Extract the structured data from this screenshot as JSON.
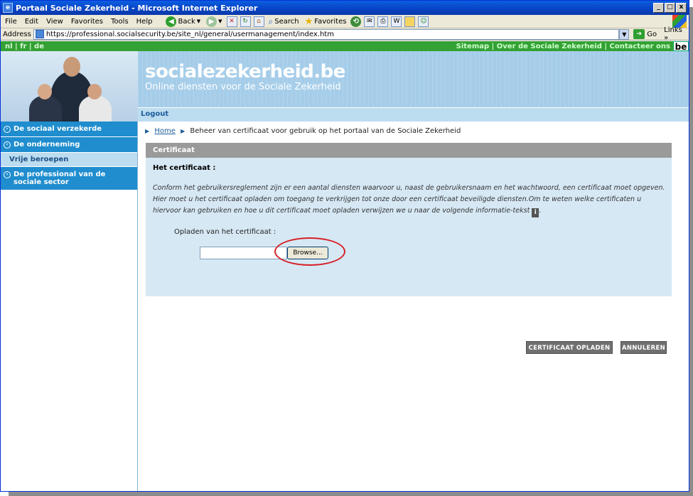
{
  "window": {
    "title": "Portaal Sociale Zekerheid - Microsoft Internet Explorer",
    "controls": [
      "_",
      "□",
      "x"
    ]
  },
  "menu": [
    "File",
    "Edit",
    "View",
    "Favorites",
    "Tools",
    "Help"
  ],
  "toolbar": {
    "back_label": "Back",
    "search_label": "Search",
    "favorites_label": "Favorites"
  },
  "address": {
    "label": "Address",
    "url": "https://professional.socialsecurity.be/site_nl/general/usermanagement/index.htm",
    "go_label": "Go",
    "links_label": "Links »"
  },
  "langbar": {
    "langs": "nl | fr | de",
    "top_links": "Sitemap | Over de Sociale Zekerheid | Contacteer ons",
    "be_logo": "be"
  },
  "banner": {
    "site_name": "socialezekerheid.be",
    "tagline": "Online diensten voor de Sociale Zekerheid"
  },
  "logout_label": "Logout",
  "sidebar": {
    "items": [
      {
        "label": "De sociaal verzekerde"
      },
      {
        "label": "De onderneming"
      },
      {
        "label": "Vrije beroepen"
      },
      {
        "label": "De professional van de sociale sector"
      }
    ]
  },
  "breadcrumb": {
    "home": "Home",
    "current": "Beheer van certificaat voor gebruik op het portaal van de Sociale Zekerheid"
  },
  "panel": {
    "header": "Certificaat",
    "subtitle": "Het certificaat :",
    "body": "Conform het gebruikersreglement zijn er een aantal diensten waarvoor u, naast de gebruikersnaam en het wachtwoord, een certificaat moet opgeven. Hier moet u het certificaat opladen om toegang te verkrijgen tot onze door een certificaat beveiligde diensten.Om te weten welke certificaten u hiervoor kan gebruiken en hoe u dit certificaat moet opladen verwijzen we u naar de volgende informatie-tekst",
    "upload_label": "Opladen van het certificaat :",
    "file_value": "",
    "browse_label": "Browse..."
  },
  "buttons": {
    "upload": "CERTIFICAAT OPLADEN",
    "cancel": "ANNULEREN"
  },
  "colors": {
    "sidebar_blue": "#1f8dce",
    "banner_blue": "#a5cde9",
    "lang_green": "#33a133",
    "highlight_red": "#d71f26"
  }
}
